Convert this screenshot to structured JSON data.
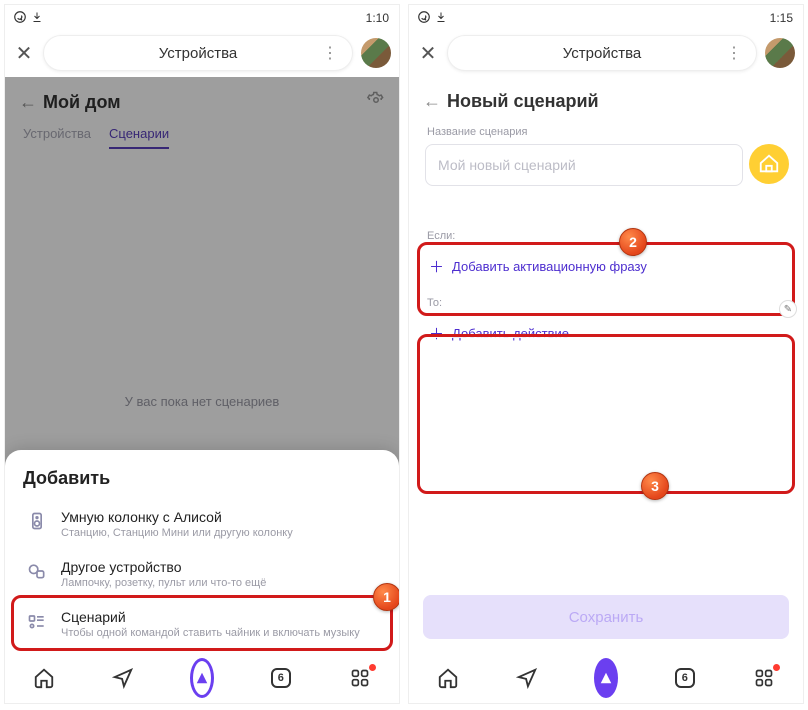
{
  "statusbar": {
    "time_left": "1:10",
    "time_right": "1:15"
  },
  "header": {
    "title": "Устройства"
  },
  "left": {
    "home_title": "Мой дом",
    "tabs": {
      "devices": "Устройства",
      "scenarios": "Сценарии"
    },
    "empty_text": "У вас пока нет сценариев",
    "sheet_title": "Добавить",
    "items": [
      {
        "title": "Умную колонку с Алисой",
        "subtitle": "Станцию, Станцию Мини или другую колонку"
      },
      {
        "title": "Другое устройство",
        "subtitle": "Лампочку, розетку, пульт или что-то ещё"
      },
      {
        "title": "Сценарий",
        "subtitle": "Чтобы одной командой ставить чайник и включать музыку"
      }
    ]
  },
  "right": {
    "page_title": "Новый сценарий",
    "name_label": "Название сценария",
    "name_placeholder": "Мой новый сценарий",
    "if_label": "Если:",
    "add_phrase": "Добавить активационную фразу",
    "then_label": "То:",
    "add_action": "Добавить действие",
    "save": "Сохранить"
  },
  "badges": {
    "b1": "1",
    "b2": "2",
    "b3": "3"
  },
  "nav": {
    "tab_count": "6"
  }
}
